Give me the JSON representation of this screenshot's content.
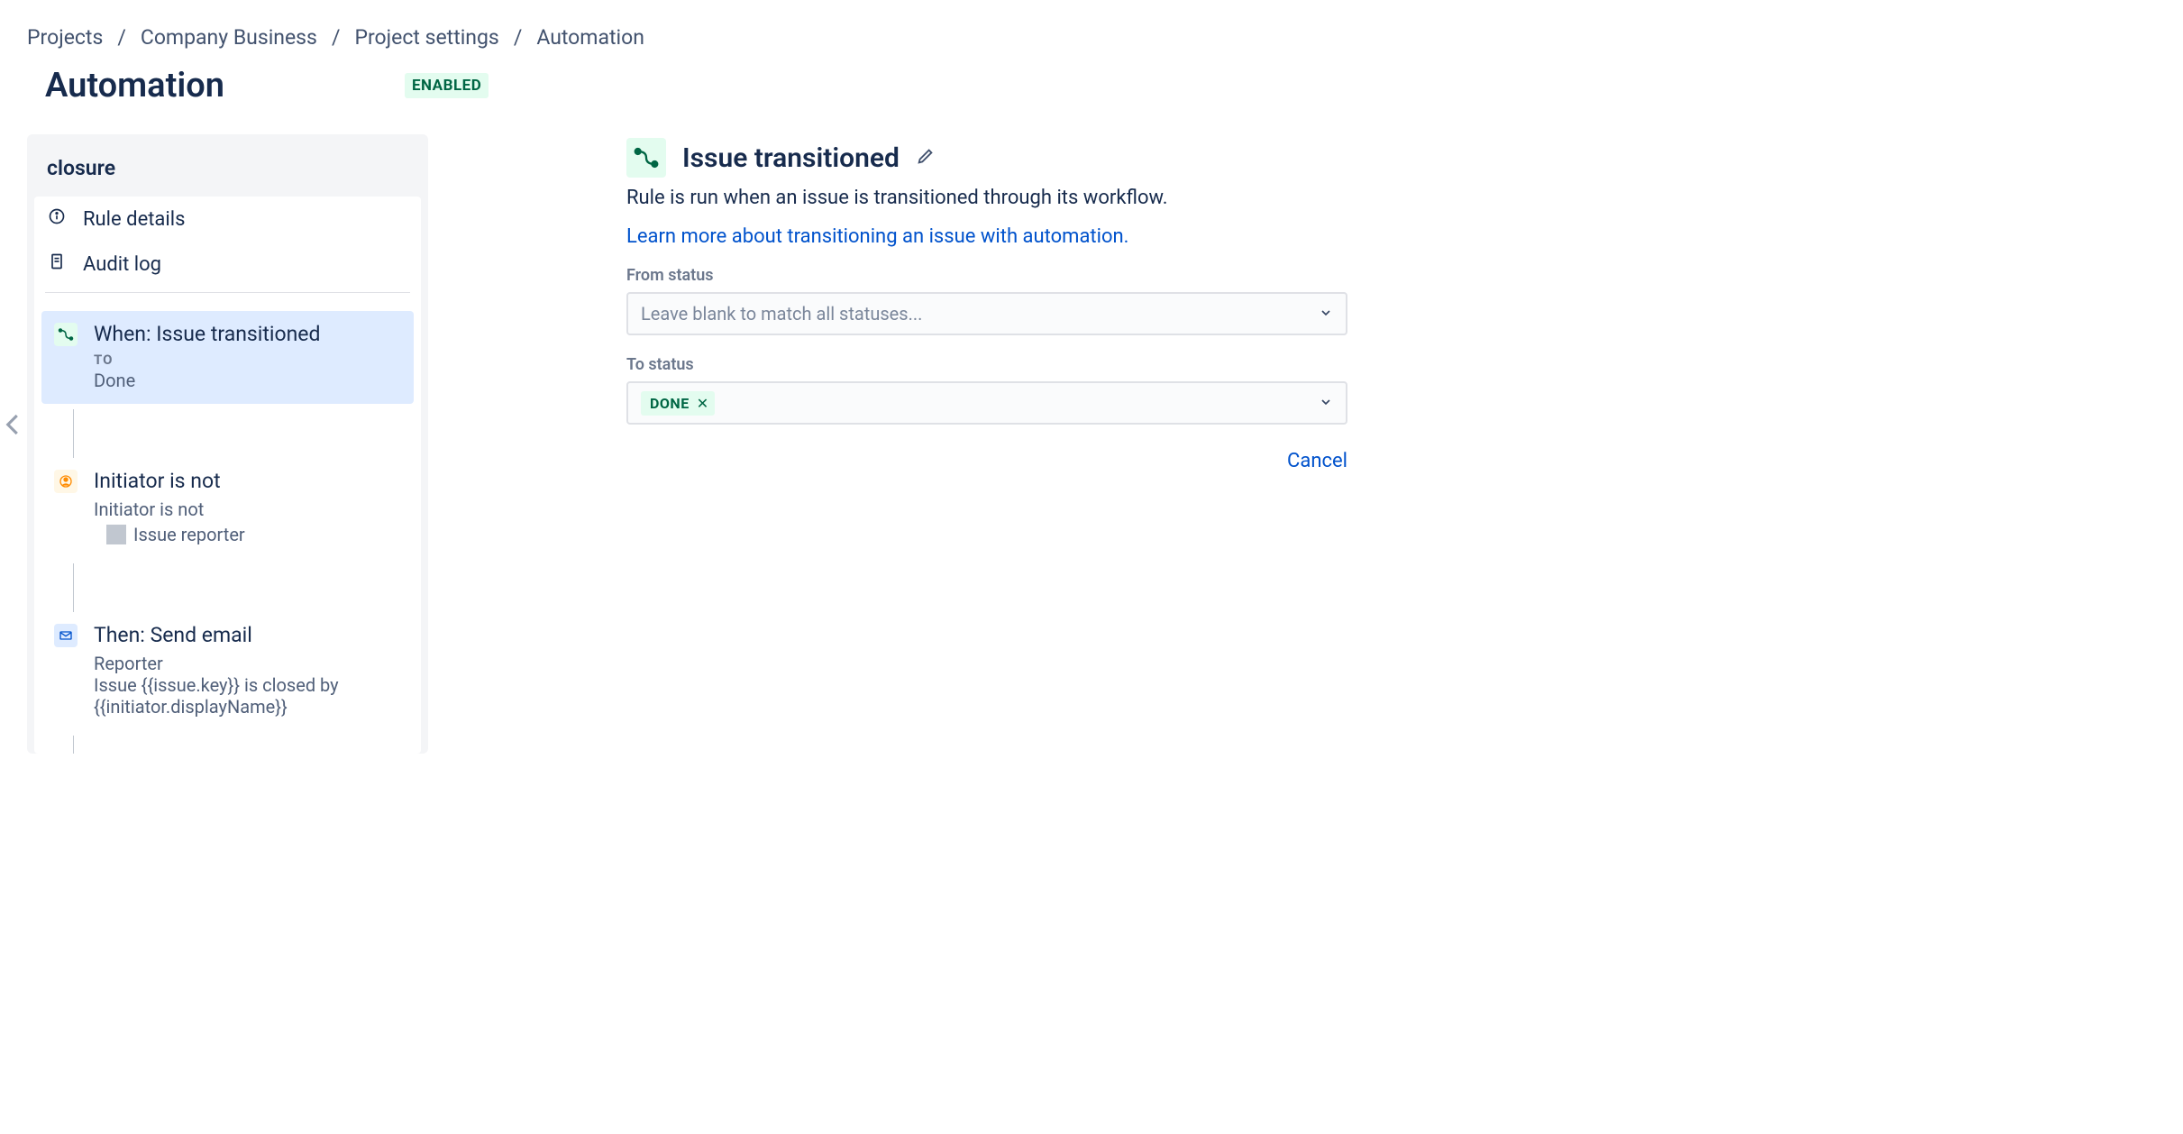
{
  "breadcrumb": {
    "projects": "Projects",
    "company": "Company Business",
    "settings": "Project settings",
    "automation": "Automation"
  },
  "page": {
    "title": "Automation",
    "status": "ENABLED"
  },
  "rule": {
    "name": "closure",
    "nav": {
      "details": "Rule details",
      "audit": "Audit log"
    },
    "steps": {
      "trigger": {
        "title": "When: Issue transitioned",
        "to_label": "TO",
        "to_value": "Done"
      },
      "condition": {
        "title": "Initiator is not",
        "line1": "Initiator is not",
        "reporter": "Issue reporter"
      },
      "action": {
        "title": "Then: Send email",
        "line1": "Reporter",
        "line2": "Issue {{issue.key}} is closed by {{initiator.displayName}}"
      }
    }
  },
  "detail": {
    "title": "Issue transitioned",
    "description": "Rule is run when an issue is transitioned through its workflow.",
    "learn_more": "Learn more about transitioning an issue with automation.",
    "from_label": "From status",
    "from_placeholder": "Leave blank to match all statuses...",
    "to_label": "To status",
    "to_tag": "DONE",
    "cancel": "Cancel"
  }
}
